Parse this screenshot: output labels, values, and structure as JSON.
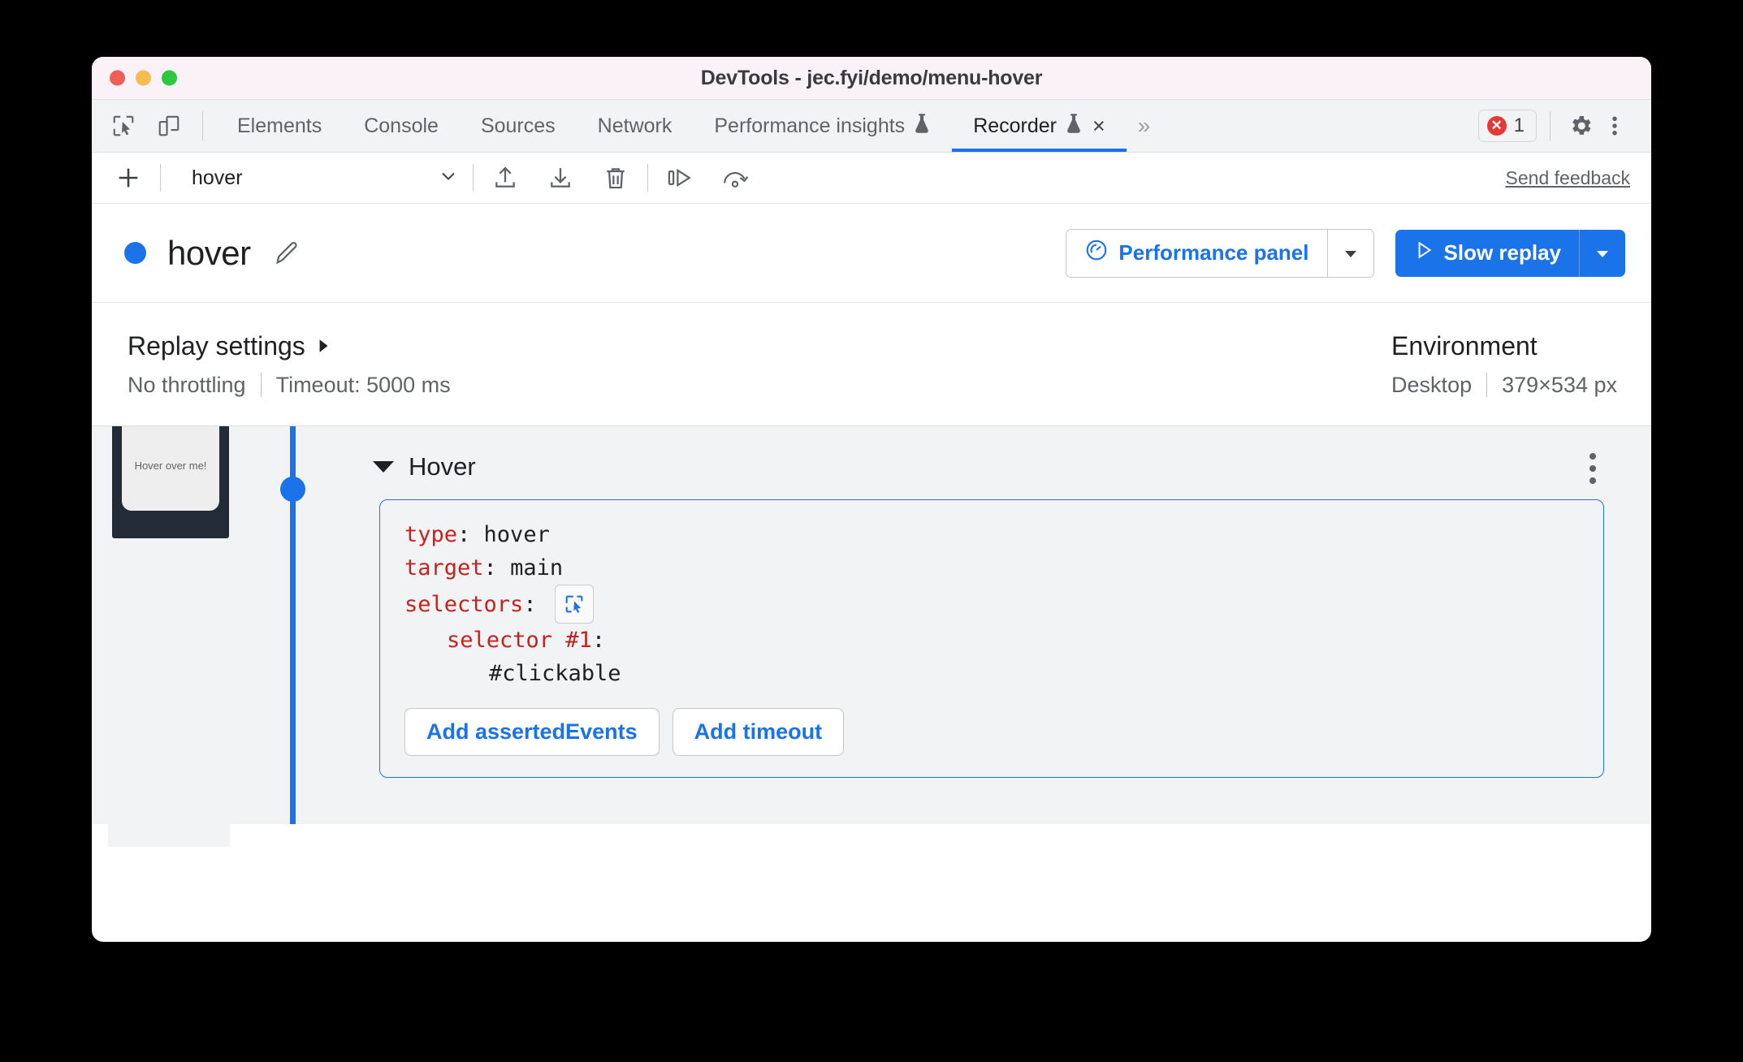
{
  "window": {
    "title": "DevTools - jec.fyi/demo/menu-hover",
    "traffic_lights": [
      "close-red",
      "minimize-yellow",
      "maximize-green"
    ]
  },
  "tabbar": {
    "left_icons": [
      {
        "name": "inspect-element-icon"
      },
      {
        "name": "device-toolbar-icon"
      }
    ],
    "tabs": [
      {
        "label": "Elements",
        "active": false,
        "experimental": false,
        "closable": false
      },
      {
        "label": "Console",
        "active": false,
        "experimental": false,
        "closable": false
      },
      {
        "label": "Sources",
        "active": false,
        "experimental": false,
        "closable": false
      },
      {
        "label": "Network",
        "active": false,
        "experimental": false,
        "closable": false
      },
      {
        "label": "Performance insights",
        "active": false,
        "experimental": true,
        "closable": false
      },
      {
        "label": "Recorder",
        "active": true,
        "experimental": true,
        "closable": true
      }
    ],
    "overflow_label": "»",
    "close_label": "×",
    "error_badge": {
      "count": "1",
      "color": "#e53935",
      "icon": "error-circle-icon"
    },
    "settings_icon": "gear-icon",
    "more_icon": "kebab-menu-icon"
  },
  "recorder_toolbar": {
    "add_label": "+",
    "recording_name": "hover",
    "dropdown_icon": "chevron-down-icon",
    "import_icon": "import-upload-icon",
    "export_icon": "export-download-icon",
    "delete_icon": "trash-icon",
    "step_icon": "step-over-icon",
    "replay_icon": "replay-arc-icon",
    "feedback_label": "Send feedback"
  },
  "recording_header": {
    "status_dot_color": "#1a73e8",
    "title": "hover",
    "edit_icon": "pencil-icon",
    "perf_button": {
      "label": "Performance panel",
      "icon": "gauge-icon",
      "dropdown_icon": "caret-down-icon"
    },
    "replay_button": {
      "label": "Slow replay",
      "icon": "play-triangle-icon",
      "dropdown_icon": "caret-down-icon"
    }
  },
  "settings_strip": {
    "replay": {
      "title": "Replay settings",
      "expand_icon": "caret-right-icon",
      "throttling": "No throttling",
      "timeout": "Timeout: 5000 ms"
    },
    "environment": {
      "title": "Environment",
      "device": "Desktop",
      "viewport": "379×534 px"
    }
  },
  "steps": {
    "thumbnail_text": "Hover over me!",
    "step": {
      "name": "Hover",
      "expand_icon": "caret-down-icon",
      "menu_icon": "kebab-menu-icon",
      "code": [
        {
          "key": "type",
          "sep": ": ",
          "value": "hover",
          "indent": 0
        },
        {
          "key": "target",
          "sep": ": ",
          "value": "main",
          "indent": 0
        },
        {
          "key": "selectors",
          "sep": ":",
          "value": "",
          "indent": 0,
          "picker_icon": "select-element-icon"
        },
        {
          "key": "selector #1",
          "sep": ":",
          "value": "",
          "indent": 1
        },
        {
          "key": "",
          "sep": "",
          "value": "#clickable",
          "indent": 2
        }
      ],
      "buttons": [
        {
          "label": "Add assertedEvents"
        },
        {
          "label": "Add timeout"
        }
      ]
    }
  },
  "colors": {
    "accent_blue": "#1a73e8",
    "code_key_red": "#c5221f",
    "panel_bg": "#f1f3f4",
    "titlebar_bg": "#faf2f6"
  }
}
